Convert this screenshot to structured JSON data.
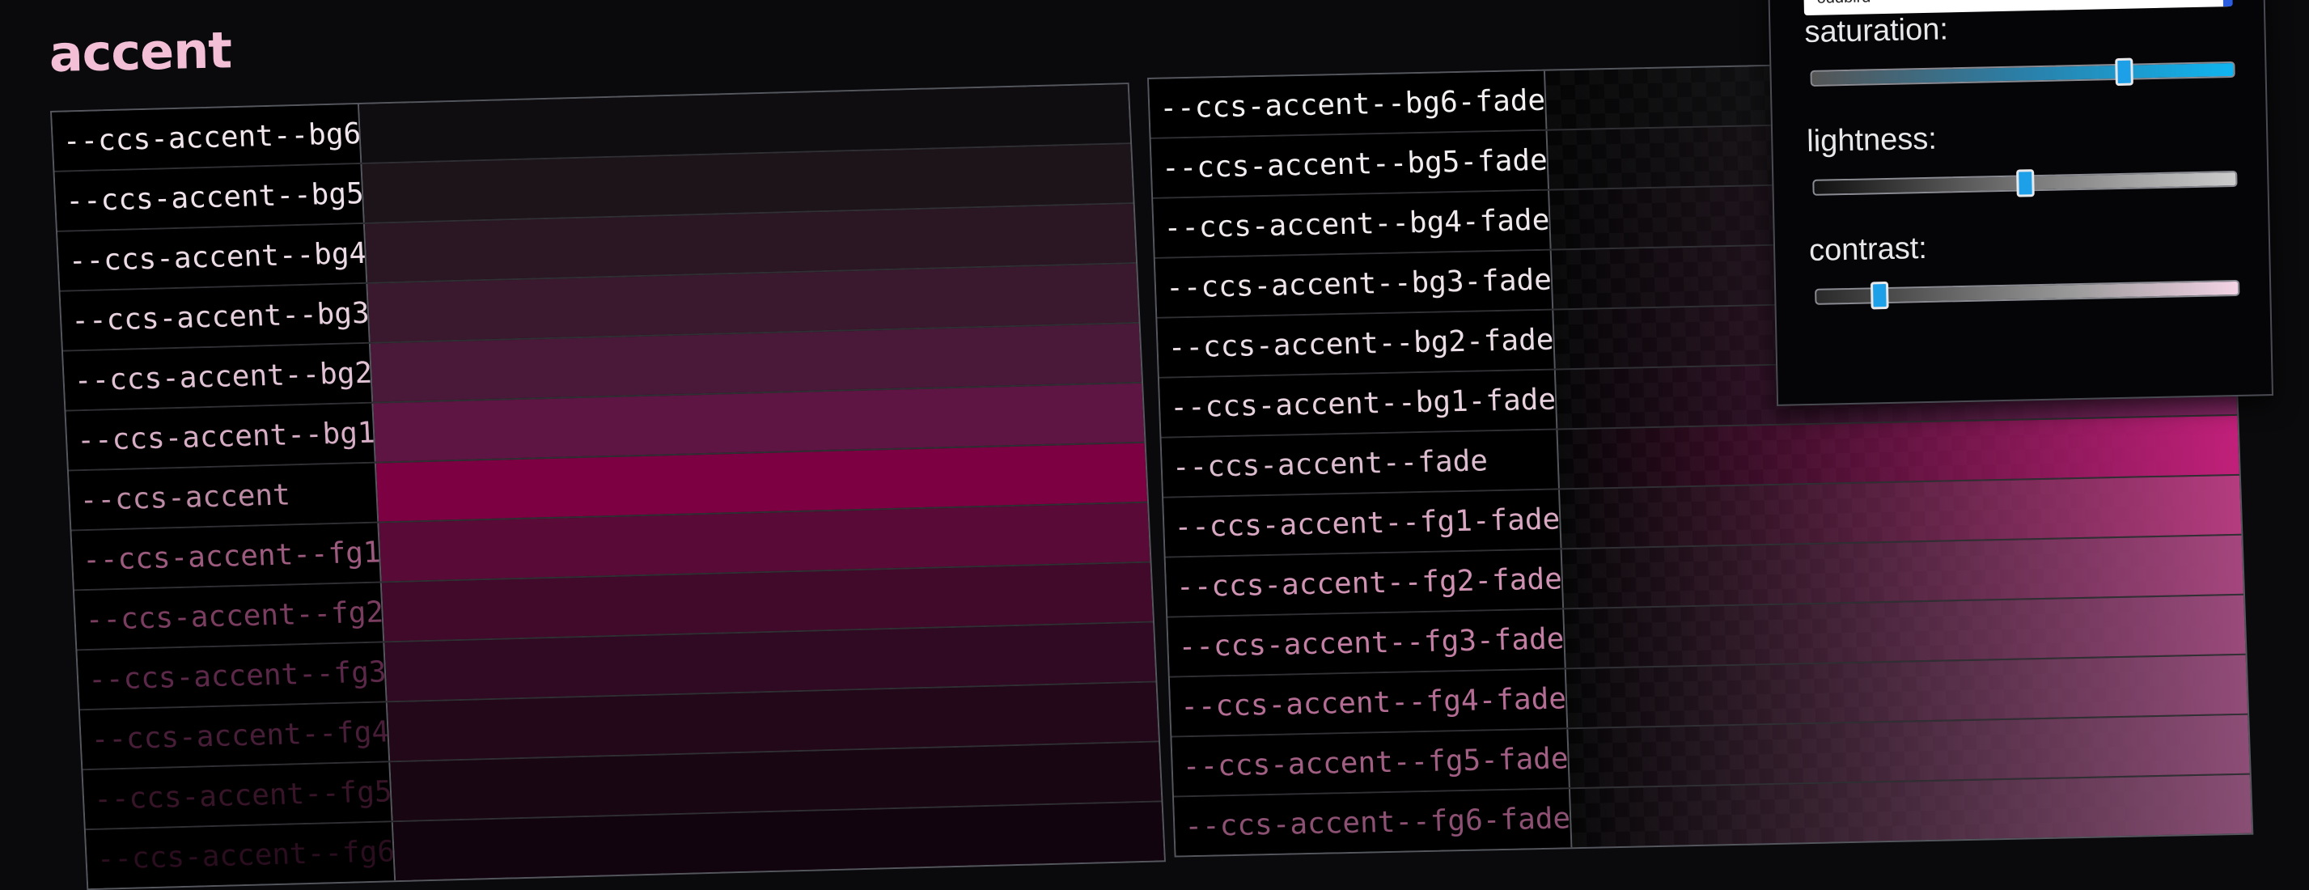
{
  "heading": "accent",
  "left_rows": [
    {
      "label": "--ccs-accent--bg6",
      "color": "#0f0d10",
      "text_color": "#f0e6ec"
    },
    {
      "label": "--ccs-accent--bg5",
      "color": "#1d141a",
      "text_color": "#efe2ea"
    },
    {
      "label": "--ccs-accent--bg4",
      "color": "#2b1623",
      "text_color": "#ecdbe5"
    },
    {
      "label": "--ccs-accent--bg3",
      "color": "#3a182d",
      "text_color": "#e7d0dd"
    },
    {
      "label": "--ccs-accent--bg2",
      "color": "#4a1838",
      "text_color": "#e0c2d4"
    },
    {
      "label": "--ccs-accent--bg1",
      "color": "#5e1543",
      "text_color": "#d6adc5"
    },
    {
      "label": "--ccs-accent",
      "color": "#7d0042",
      "text_color": "#bd8aa5"
    },
    {
      "label": "--ccs-accent--fg1",
      "color": "#5a0a36",
      "text_color": "#9c5a7e"
    },
    {
      "label": "--ccs-accent--fg2",
      "color": "#420a2a",
      "text_color": "#7a3d60"
    },
    {
      "label": "--ccs-accent--fg3",
      "color": "#300922",
      "text_color": "#5c2849"
    },
    {
      "label": "--ccs-accent--fg4",
      "color": "#23081a",
      "text_color": "#471d38"
    },
    {
      "label": "--ccs-accent--fg5",
      "color": "#190613",
      "text_color": "#381429"
    },
    {
      "label": "--ccs-accent--fg6",
      "color": "#12040e",
      "text_color": "#2a0d1e"
    }
  ],
  "right_rows": [
    {
      "label": "--ccs-accent--bg6-fade",
      "color": "#2a2a2e",
      "text_color": "#f3f0f2"
    },
    {
      "label": "--ccs-accent--bg5-fade",
      "color": "#3a2b35",
      "text_color": "#f2edf0"
    },
    {
      "label": "--ccs-accent--bg4-fade",
      "color": "#4b2c41",
      "text_color": "#efe8ec"
    },
    {
      "label": "--ccs-accent--bg3-fade",
      "color": "#5c2d4d",
      "text_color": "#ede3e9"
    },
    {
      "label": "--ccs-accent--bg2-fade",
      "color": "#6e2d58",
      "text_color": "#ebdde5"
    },
    {
      "label": "--ccs-accent--bg1-fade",
      "color": "#852866",
      "text_color": "#e6d1dd"
    },
    {
      "label": "--ccs-accent--fade",
      "color": "#c1207a",
      "text_color": "#dcbdcf"
    },
    {
      "label": "--ccs-accent--fg1-fade",
      "color": "#b43c7f",
      "text_color": "#d8a8c3"
    },
    {
      "label": "--ccs-accent--fg2-fade",
      "color": "#a5467e",
      "text_color": "#cf92b3"
    },
    {
      "label": "--ccs-accent--fg3-fade",
      "color": "#9a4a7b",
      "text_color": "#c27ea3"
    },
    {
      "label": "--ccs-accent--fg4-fade",
      "color": "#924c78",
      "text_color": "#b36c93"
    },
    {
      "label": "--ccs-accent--fg5-fade",
      "color": "#8d4d76",
      "text_color": "#a15e83"
    },
    {
      "label": "--ccs-accent--fg6-fade",
      "color": "#894e74",
      "text_color": "#8c5073"
    }
  ],
  "panel": {
    "input_value": "oddbird",
    "sliders": [
      {
        "label": "saturation:",
        "value": 0.74,
        "track": "linear-gradient(90deg,#555 0%,#2a7fa8 50%,#10b4f0 100%)"
      },
      {
        "label": "lightness:",
        "value": 0.5,
        "track": "linear-gradient(90deg,#111 0%,#777 50%,#ccc 100%)"
      },
      {
        "label": "contrast:",
        "value": 0.15,
        "track": "linear-gradient(90deg,#2a2a2a 0%,#999 60%,#f4d4e6 100%)"
      }
    ]
  }
}
